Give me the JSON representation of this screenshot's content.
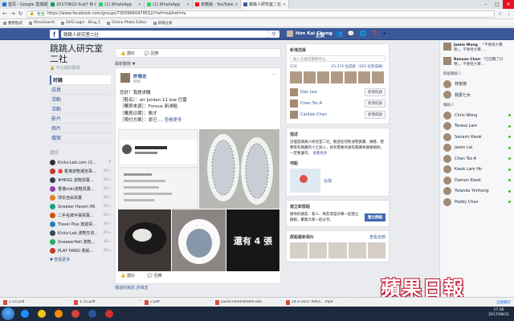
{
  "browser": {
    "tabs": [
      {
        "label": "首頁 - Google 雲端硬碟",
        "color": "#1a73e8"
      },
      {
        "label": "20170822-Sub7 Bi-Pu",
        "color": "#0f9d58"
      },
      {
        "label": "(1) WhatsApp",
        "color": "#25d366"
      },
      {
        "label": "(1) WhatsApp",
        "color": "#25d366"
      },
      {
        "label": "攻略篇 - YouTube",
        "color": "#ff0000"
      },
      {
        "label": "跳跳人研究室二社",
        "color": "#3b5998"
      }
    ],
    "url_secure": "安全",
    "url": "https://www.facebook.com/groups/730096604795S2/?ref=ts&fref=ts",
    "bookmarks": [
      "應用程式",
      "WiseSearch",
      "DUS Login - Bing_5",
      "Online Photo Editor",
      "新增分頁"
    ]
  },
  "fb": {
    "logo": "f",
    "search_value": "跳跳人研究室二社",
    "search_icon": "search-icon",
    "user_name": "Hon Kai Chung",
    "home_label": "主頁",
    "icons": [
      "friends-icon",
      "messenger-icon",
      "globe-icon",
      "help-icon",
      "chevron-down-icon"
    ]
  },
  "left": {
    "group_title": "跳跳人研究室二社",
    "group_sub": "🔒 不公開的群組",
    "nav": [
      "討論",
      "成員",
      "活動",
      "活動",
      "影片",
      "相片",
      "檔案"
    ],
    "shortcuts_header": "捷徑",
    "shortcuts": [
      {
        "label": "Kickz-Lab.com (S...",
        "count": "9",
        "color": "#333"
      },
      {
        "label": "🔴 香港波鞋潮流事...",
        "count": "20+",
        "color": "#c0392b"
      },
      {
        "label": "#HKSG 波鞋買賣...",
        "count": "20+",
        "color": "#2c3e50"
      },
      {
        "label": "香港snkr波鞋買賣...",
        "count": "20+",
        "color": "#8e44ad"
      },
      {
        "label": "球衣自由買賣",
        "count": "20+",
        "color": "#e67e22"
      },
      {
        "label": "Sneaker Haven HK",
        "count": "20+",
        "color": "#16a085"
      },
      {
        "label": "二手名牌手袋買賣...",
        "count": "20+",
        "color": "#d35400"
      },
      {
        "label": "Travel Plus 旅遊買...",
        "count": "20+",
        "color": "#2980b9"
      },
      {
        "label": "Kickz-Lab 波鞋交流...",
        "count": "20+",
        "color": "#34495e"
      },
      {
        "label": "SneakerHell 波鞋...",
        "count": "20+",
        "color": "#27ae60"
      },
      {
        "label": "PLAY HARD 我就...",
        "count": "20+",
        "color": "#c0392b"
      }
    ],
    "more": "▼ 查看更多"
  },
  "feed": {
    "actions": [
      "讚好",
      "回應"
    ],
    "sort": "最新動態 ▼",
    "post": {
      "author": "許偉志",
      "time": "剛剛",
      "lines": [
        "您好！我想求購",
        "［鞋名］：air Jordan 11 low 巴雷",
        "［購買來源］：Forous 新鴻點",
        "［購買日期］：剛才",
        "［預付方案］：原已 ... 查看更多"
      ],
      "photo_overlay": "還有 4 張",
      "actions": [
        "讚好",
        "回應"
      ]
    },
    "next_post": "傳送的資訊 許偉志"
  },
  "right": {
    "members_header": "新增成員",
    "add_placeholder": "輸入名稱或電郵地址...",
    "members_label": "成員",
    "members_count": "15,374 位成員（293 位新成員）",
    "suggestions": [
      {
        "name": "Dan Lee",
        "btn": "新增成員"
      },
      {
        "name": "Chan Tsz A",
        "btn": "新增成員"
      },
      {
        "name": "Carlisle Chan",
        "btn": "新增成員"
      }
    ],
    "desc_header": "描述",
    "desc": "這個是跳跳人研究室二社，歡迎任何對波鞋買賣、跳鞋、鞋類等有興趣的人士加入，如有需要的請先閱讀本群組規則，一定要遵守。",
    "desc_more": "查看更多",
    "location_header": "地點",
    "location": "台灣",
    "create_header": "建立新群組",
    "create_desc": "跟你的朋友、家人、隊友或是同事一起建立群組，聚集大家一起分享。",
    "create_btn": "建立群組",
    "recent_header": "群組最新相片",
    "recent_more": "查看全部"
  },
  "chat": {
    "messages": [
      {
        "name": "Jamie Wong",
        "text": "：「不要咁大聲喇」，不要咁大聲..."
      },
      {
        "name": "Ronson Chan",
        "text": "「已回覆了好嘢」，不要咁大聲..."
      }
    ],
    "section1": "群組聯絡人",
    "groups": [
      "林俊傑",
      "我愛七女"
    ],
    "section2": "聯絡人",
    "contacts": [
      "Chris Wong",
      "Teresa Lam",
      "Sanami Kwok",
      "Jason Lai",
      "Chan Tsz A",
      "Kwok Lam Ho",
      "Damon Kwok",
      "Yolanda Yimhong",
      "Paddy Chan"
    ],
    "search": "搜尋"
  },
  "watermark": "蘋果日報",
  "downloads": {
    "items": [
      "1 (2).pdf",
      "1 (1).pdf",
      "2.pdf",
      "QuickTimeInstaller.exe",
      "24-5-2017 KitLe....mp4"
    ],
    "show_all": "全部顯示"
  },
  "taskbar": {
    "apps": [
      {
        "name": "ie",
        "color": "#1e90ff"
      },
      {
        "name": "explorer",
        "color": "#f5c518"
      },
      {
        "name": "player",
        "color": "#ff8c00"
      },
      {
        "name": "chrome",
        "color": "#db4437"
      },
      {
        "name": "word",
        "color": "#2b579a"
      },
      {
        "name": "acrobat",
        "color": "#d32f2f"
      }
    ],
    "time": "17:36",
    "date": "2017/08/31"
  }
}
